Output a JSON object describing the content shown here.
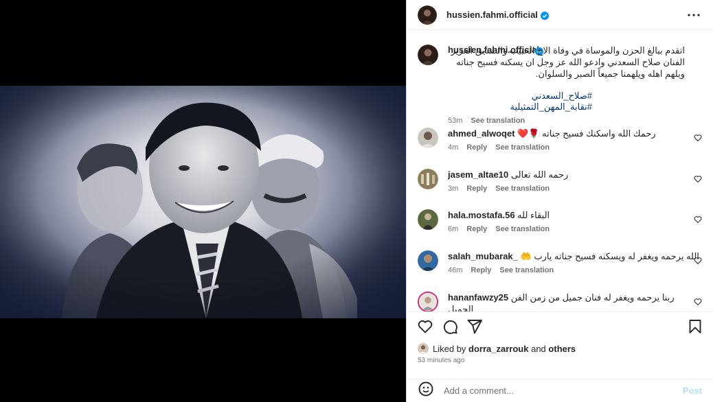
{
  "header": {
    "username": "hussien.fahmi.official"
  },
  "caption": {
    "username": "hussien.fahmi.official",
    "text": "اتقدم ببالغ الحزن والموساة في وفاة الاخ الحبيب والصديق العزيز الفنان صلاح السعدني وادعو الله عز وجل ان يسكنه فسيح جناته ويلهم اهله ويلهمنا جميعاً الصبر والسلوان.",
    "hashtags": "#صلاح_السعدني #نقابة_المهن_التمثيلية",
    "time": "53m",
    "see_translation": "See translation"
  },
  "comments": [
    {
      "username": "ahmed_alwoqet",
      "text": "رحمك الله واسكنك فسيح جناته 🌹❤️",
      "time": "4m",
      "reply": "Reply",
      "see_translation": "See translation"
    },
    {
      "username": "jasem_altae10",
      "text": "رحمه الله تعالى",
      "time": "3m",
      "reply": "Reply",
      "see_translation": "See translation"
    },
    {
      "username": "hala.mostafa.56",
      "text": "البقاء لله",
      "time": "6m",
      "reply": "Reply",
      "see_translation": "See translation"
    },
    {
      "username": "salah_mubarak_",
      "text": "الله يرحمه ويغفر له ويسكنه فسيح جناته يارب 🤲",
      "time": "46m",
      "reply": "Reply",
      "see_translation": "See translation"
    },
    {
      "username": "hananfawzy25",
      "text": "ربنا يرحمه ويغفر له فنان جميل من زمن الفن الجميل",
      "time": "",
      "reply": "",
      "see_translation": ""
    }
  ],
  "likes": {
    "prefix": "Liked by",
    "user": "dorra_zarrouk",
    "and": "and",
    "others": "others",
    "time": "53 minutes ago"
  },
  "add_comment": {
    "placeholder": "Add a comment...",
    "post_label": "Post"
  },
  "colors": {
    "verified": "#0095f6",
    "link": "#00376b",
    "muted": "#737373",
    "post_disabled": "#b2dffc"
  }
}
